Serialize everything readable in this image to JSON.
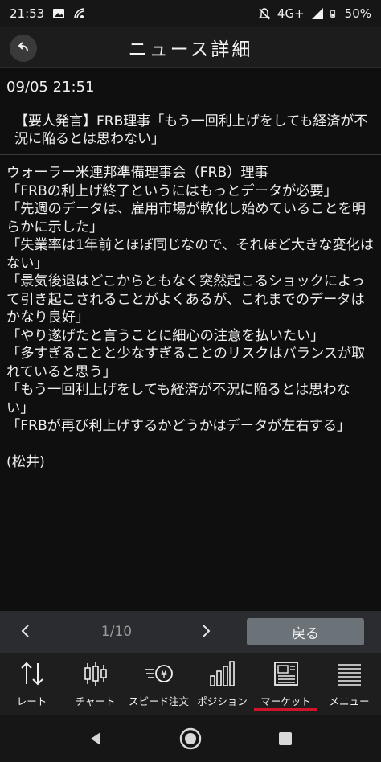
{
  "status_bar": {
    "time": "21:53",
    "network": "4G+",
    "battery": "50%",
    "icons": [
      "image-icon",
      "signal-on-icon",
      "mute-icon",
      "signal-strength-icon",
      "battery-icon"
    ]
  },
  "header": {
    "title": "ニュース詳細",
    "back_icon": "back-arrow-icon"
  },
  "article": {
    "datetime": "09/05 21:51",
    "headline": "【要人発言】FRB理事「もう一回利上げをしても経済が不況に陥るとは思わない」",
    "body": "ウォーラー米連邦準備理事会（FRB）理事\n「FRBの利上げ終了というにはもっとデータが必要」\n「先週のデータは、雇用市場が軟化し始めていることを明らかに示した」\n「失業率は1年前とほぼ同じなので、それほど大きな変化はない」\n「景気後退はどこからともなく突然起こるショックによって引き起こされることがよくあるが、これまでのデータはかなり良好」\n「やり遂げたと言うことに細心の注意を払いたい」\n「多すぎることと少なすぎることのリスクはバランスが取れていると思う」\n「もう一回利上げをしても経済が不況に陥るとは思わない」\n「FRBが再び利上げするかどうかはデータが左右する」\n\n(松井)"
  },
  "pager": {
    "prev": "‹",
    "count": "1/10",
    "next": "›",
    "return_label": "戻る"
  },
  "tabs": [
    {
      "label": "レート",
      "icon": "rate-arrows-icon",
      "active": false
    },
    {
      "label": "チャート",
      "icon": "candlestick-chart-icon",
      "active": false
    },
    {
      "label": "スピード注文",
      "icon": "yen-speed-icon",
      "active": false
    },
    {
      "label": "ポジション",
      "icon": "bar-chart-icon",
      "active": false
    },
    {
      "label": "マーケット",
      "icon": "newspaper-icon",
      "active": true
    },
    {
      "label": "メニュー",
      "icon": "menu-icon",
      "active": false
    }
  ],
  "colors": {
    "background": "#0f0f0f",
    "active_underline": "#d0152a",
    "return_button": "#6b7278"
  }
}
